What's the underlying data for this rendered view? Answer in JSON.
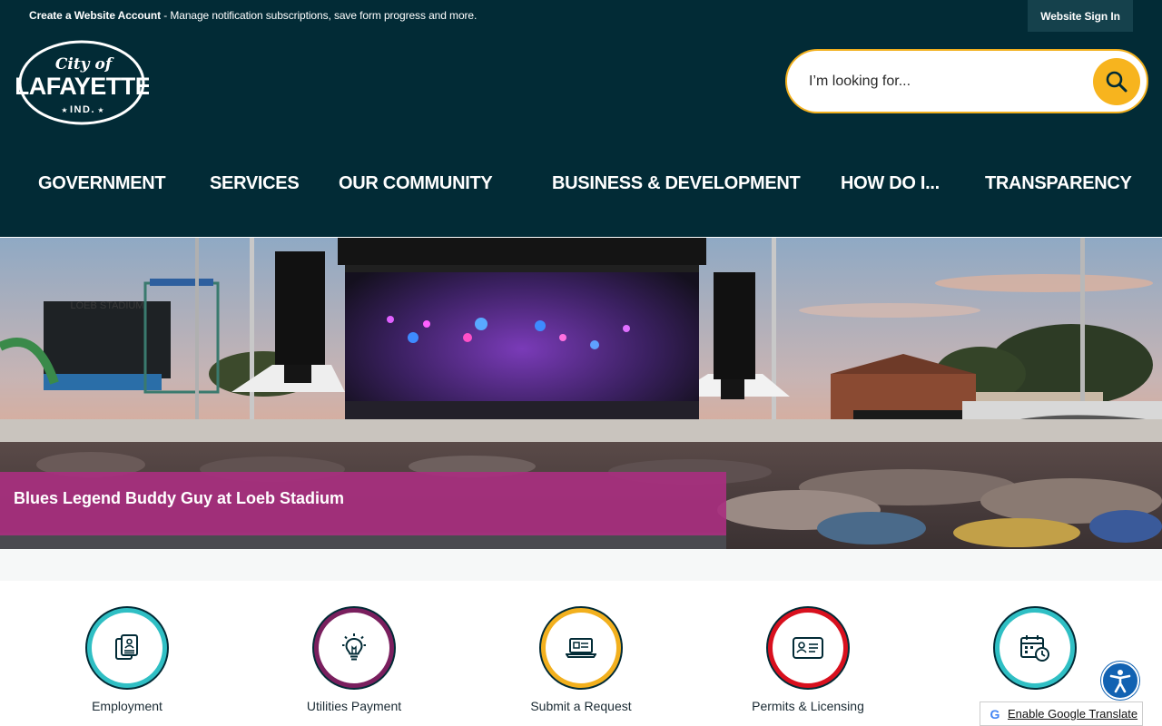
{
  "topbar": {
    "create_account": "Create a Website Account",
    "message": " - Manage notification subscriptions, save form progress and more.",
    "sign_in": "Website Sign In"
  },
  "logo": {
    "line1": "City of",
    "line2": "LAFAYETTE",
    "line3": "IND."
  },
  "search": {
    "placeholder": "I’m looking for..."
  },
  "nav": [
    {
      "label": "GOVERNMENT"
    },
    {
      "label": "SERVICES"
    },
    {
      "label": "OUR COMMUNITY"
    },
    {
      "label": "BUSINESS & DEVELOPMENT"
    },
    {
      "label": "HOW DO I..."
    },
    {
      "label": "TRANSPARENCY"
    }
  ],
  "hero": {
    "caption": "Blues Legend Buddy Guy at Loeb Stadium",
    "scoreboard_text": "LOEB STADIUM"
  },
  "quick_links": [
    {
      "label": "Employment",
      "color": "#2fbfc4",
      "icon": "documents-icon"
    },
    {
      "label": "Utilities Payment",
      "color": "#7a1f5e",
      "icon": "lightbulb-icon"
    },
    {
      "label": "Submit a Request",
      "color": "#f2b01e",
      "icon": "laptop-icon"
    },
    {
      "label": "Permits & Licensing",
      "color": "#d8101e",
      "icon": "id-card-icon"
    },
    {
      "label": "",
      "color": "#2fbfc4",
      "icon": "calendar-icon"
    }
  ],
  "translate": {
    "label": "Enable Google Translate"
  },
  "colors": {
    "header_bg": "#022b36",
    "accent_yellow": "#f7b41e",
    "caption_magenta": "#a82f7f",
    "accessibility_blue": "#1162b2"
  }
}
